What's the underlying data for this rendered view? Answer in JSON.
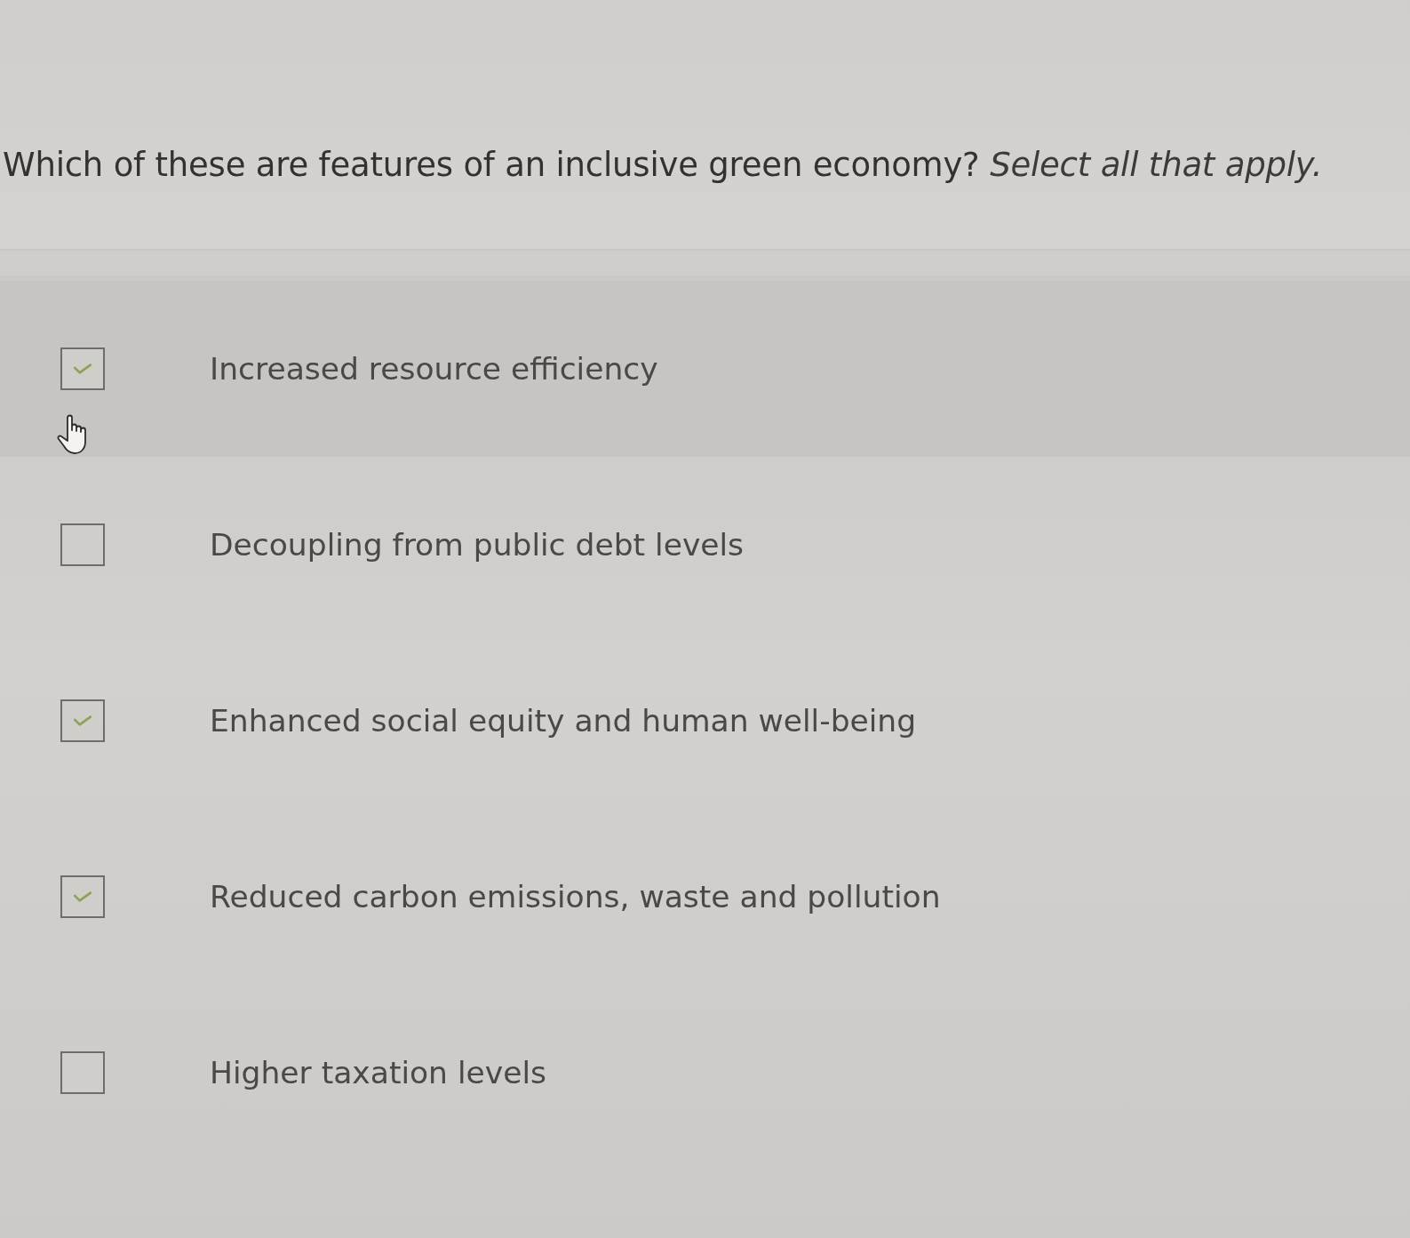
{
  "question": {
    "text": "Which of these are features of an inclusive green economy? *Select all that apply.*"
  },
  "options": [
    {
      "label": "Increased resource efficiency",
      "checked": true,
      "hovered": true
    },
    {
      "label": "Decoupling from public debt levels",
      "checked": false,
      "hovered": false
    },
    {
      "label": "Enhanced social equity and human well-being",
      "checked": true,
      "hovered": false
    },
    {
      "label": "Reduced carbon emissions, waste and pollution",
      "checked": true,
      "hovered": false
    },
    {
      "label": "Higher taxation levels",
      "checked": false,
      "hovered": false
    }
  ]
}
